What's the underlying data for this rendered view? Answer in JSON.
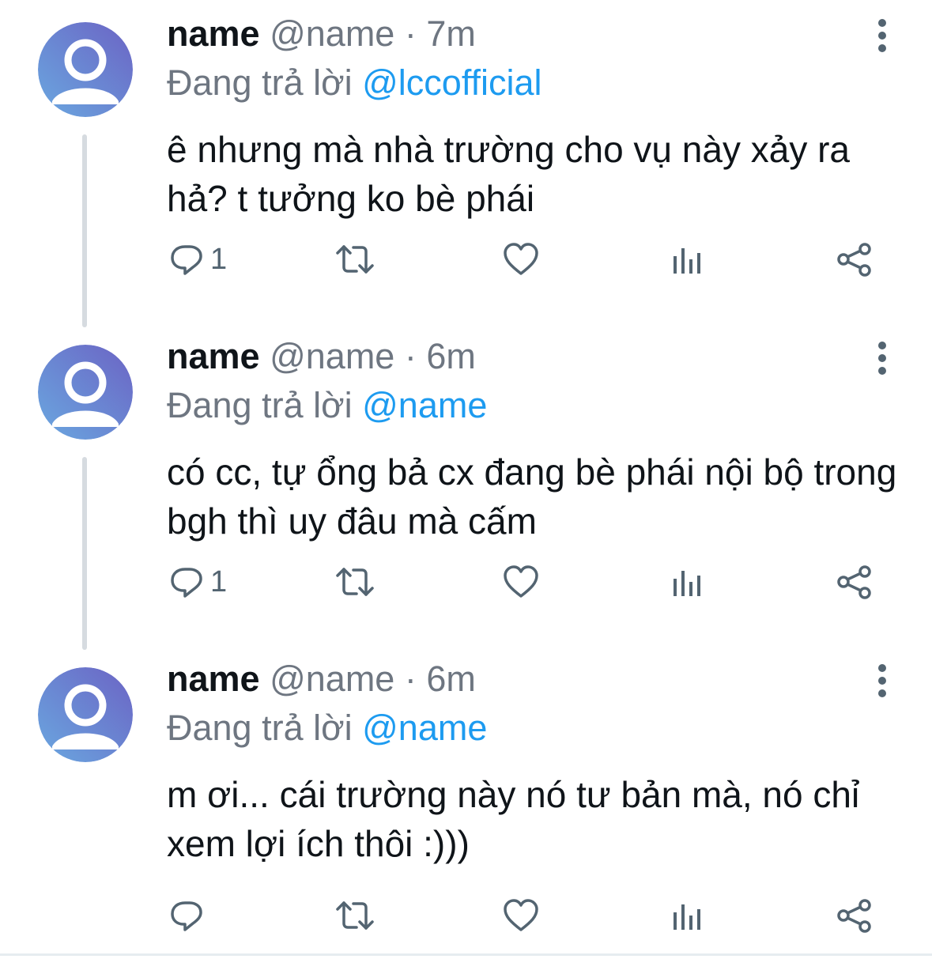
{
  "tweets": [
    {
      "name": "name",
      "handle": "@name",
      "separator": "·",
      "time": "7m",
      "reply_prefix": "Đang trả lời",
      "reply_to": "@lccofficial",
      "text": "ê nhưng mà nhà trường cho vụ này xảy ra hả? t tưởng ko bè phái",
      "reply_count": "1"
    },
    {
      "name": "name",
      "handle": "@name",
      "separator": "·",
      "time": "6m",
      "reply_prefix": "Đang trả lời",
      "reply_to": "@name",
      "text": "có cc, tự ổng bả cx đang bè phái nội bộ trong bgh thì uy đâu mà cấm",
      "reply_count": "1"
    },
    {
      "name": "name",
      "handle": "@name",
      "separator": "·",
      "time": "6m",
      "reply_prefix": "Đang trả lời",
      "reply_to": "@name",
      "text": "m ơi... cái trường này nó tư bản mà, nó chỉ xem lợi ích thôi :)))",
      "reply_count": ""
    }
  ],
  "icons": {
    "reply": "reply-icon",
    "retweet": "retweet-icon",
    "like": "heart-icon",
    "views": "views-icon",
    "share": "share-icon",
    "more": "more-vertical-icon",
    "avatar": "default-avatar-icon"
  },
  "colors": {
    "mention": "#1d9bf0",
    "secondary_text": "#6e7681",
    "icon": "#536471",
    "avatar_start": "#6aa8e0",
    "avatar_end": "#6b6fc4"
  }
}
